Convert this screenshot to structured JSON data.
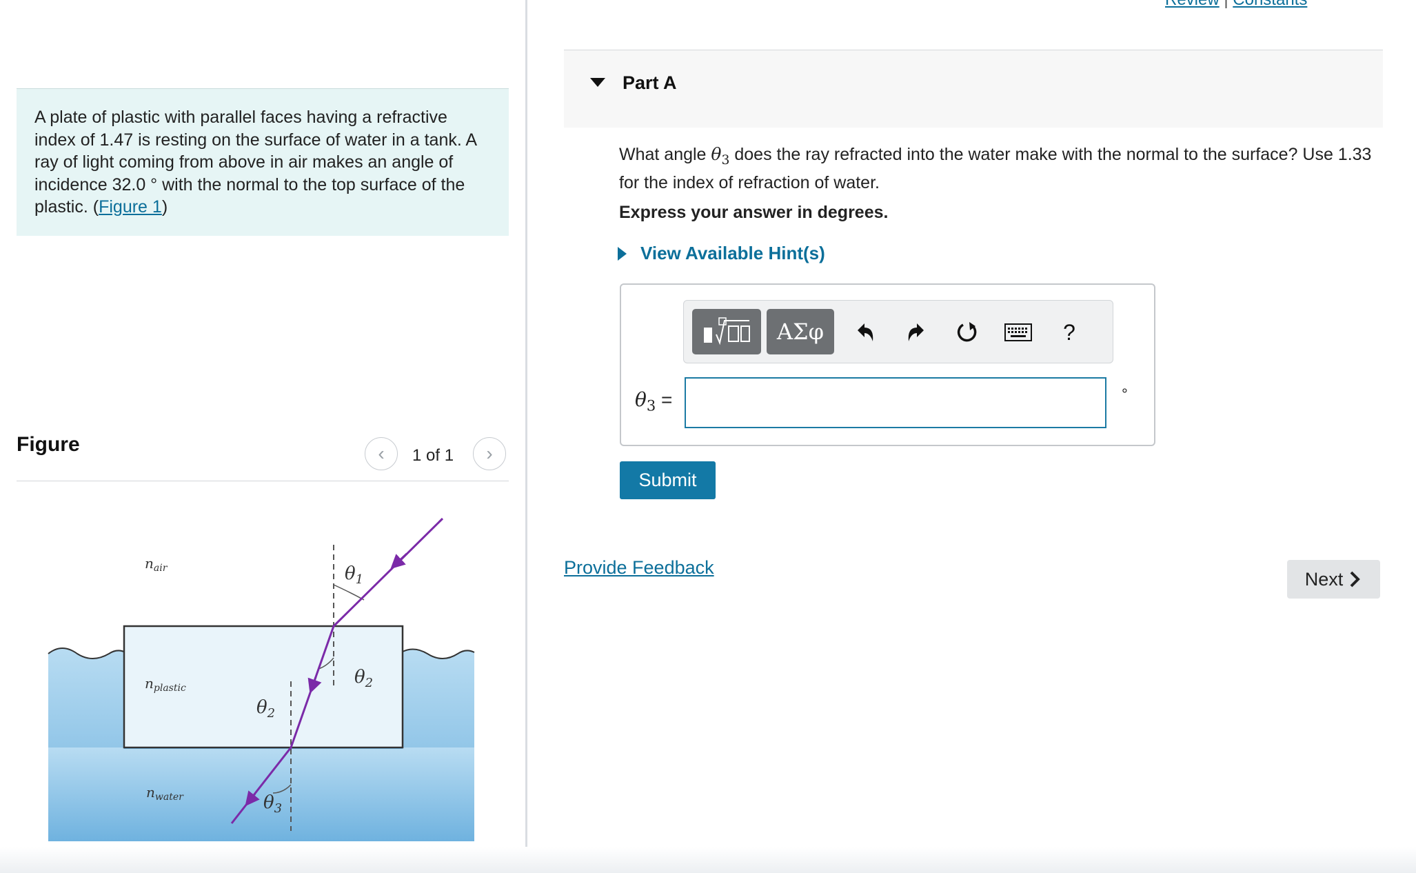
{
  "header": {
    "links": [
      "Review",
      "Constants"
    ]
  },
  "problem": {
    "text": "A plate of plastic with parallel faces having a refractive index of 1.47 is resting on the surface of water in a tank. A ray of light coming from above in air makes an angle of incidence 32.0 ° with the normal to the top surface of the plastic.",
    "link_text": "Figure 1"
  },
  "figure": {
    "title": "Figure",
    "count": "1 of 1",
    "labels": {
      "air": "n",
      "air_sub": "air",
      "plastic": "n",
      "plastic_sub": "plastic",
      "water": "n",
      "water_sub": "water",
      "theta1": "θ",
      "theta1_sub": "1",
      "theta2_top": "θ",
      "theta2_top_sub": "2",
      "theta2_bottom": "θ",
      "theta2_bottom_sub": "2",
      "theta3": "θ",
      "theta3_sub": "3"
    }
  },
  "part": {
    "title": "Part A",
    "question_before": "What angle ",
    "question_symbol": "θ",
    "question_symbol_sub": "3",
    "question_after": " does the ray refracted into the water make with the normal to the surface? Use 1.33 for the index of refraction of water.",
    "instruction": "Express your answer in degrees.",
    "hint_label": "View Available Hint(s)",
    "answer_label": "θ",
    "answer_label_sub": "3",
    "answer_equals": "=",
    "answer_value": "",
    "unit": "°",
    "toolbar": {
      "templates_icon": "templates-icon",
      "greek_label": "ΑΣφ",
      "undo_icon": "undo-icon",
      "redo_icon": "redo-icon",
      "reset_icon": "reset-icon",
      "keyboard_icon": "keyboard-icon",
      "help_label": "?"
    },
    "submit_label": "Submit"
  },
  "footer": {
    "feedback_label": "Provide Feedback",
    "next_label": "Next"
  },
  "colors": {
    "accent": "#1379a6",
    "link": "#0c6f9a",
    "problem_bg": "#e6f5f5",
    "ray": "#7b2aa8",
    "water": "#8cc3e6"
  }
}
